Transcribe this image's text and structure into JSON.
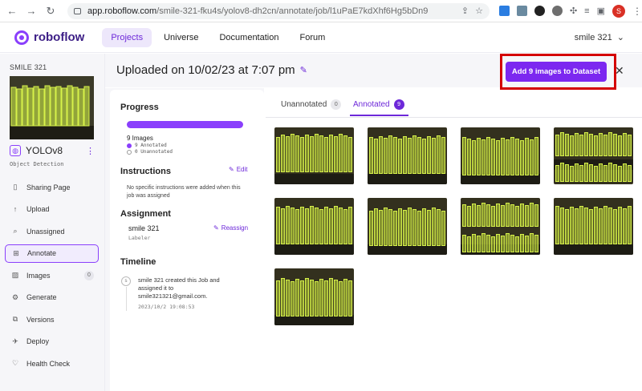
{
  "browser": {
    "url_host": "app.roboflow.com",
    "url_path": "/smile-321-fku4s/yolov8-dh2cn/annotate/job/l1uPaE7kdXhf6Hg5bDn9",
    "profile_initial": "S"
  },
  "header": {
    "brand": "roboflow",
    "nav": [
      "Projects",
      "Universe",
      "Documentation",
      "Forum"
    ],
    "active_nav": "Projects",
    "user": "smile 321"
  },
  "sidebar": {
    "workspace": "SMILE 321",
    "project_name": "YOLOv8",
    "project_type": "Object Detection",
    "items": [
      {
        "label": "Sharing Page",
        "icon": "page-icon"
      },
      {
        "label": "Upload",
        "icon": "upload-icon"
      },
      {
        "label": "Unassigned",
        "icon": "search-icon"
      },
      {
        "label": "Annotate",
        "icon": "annotate-icon",
        "active": true
      },
      {
        "label": "Images",
        "icon": "images-icon",
        "badge": "0"
      },
      {
        "label": "Generate",
        "icon": "generate-icon"
      },
      {
        "label": "Versions",
        "icon": "versions-icon"
      },
      {
        "label": "Deploy",
        "icon": "deploy-icon"
      },
      {
        "label": "Health Check",
        "icon": "health-icon"
      }
    ]
  },
  "job": {
    "title": "Uploaded on 10/02/23 at 7:07 pm",
    "add_button": "Add 9 images to Dataset"
  },
  "progress": {
    "heading": "Progress",
    "images_label": "9 Images",
    "annotated": "9 Annotated",
    "unannotated": "0 Unannotated",
    "annotated_fraction": 1.0
  },
  "instructions": {
    "heading": "Instructions",
    "edit_label": "Edit",
    "text": "No specific instructions were added when this job was assigned"
  },
  "assignment": {
    "heading": "Assignment",
    "user": "smile 321",
    "role": "Labeler",
    "reassign_label": "Reassign"
  },
  "timeline": {
    "heading": "Timeline",
    "avatar": "s",
    "event": "smile 321 created this Job and assigned it to smile321321@gmail.com.",
    "time": "2023/10/2 19:08:53"
  },
  "tabs": [
    {
      "label": "Unannotated",
      "count": "0"
    },
    {
      "label": "Annotated",
      "count": "9",
      "active": true
    }
  ],
  "colors": {
    "accent": "#6d28d9",
    "button": "#7c28f0",
    "highlight_border": "#d40000",
    "annotation": "#d7f24a"
  },
  "image_count": 9
}
